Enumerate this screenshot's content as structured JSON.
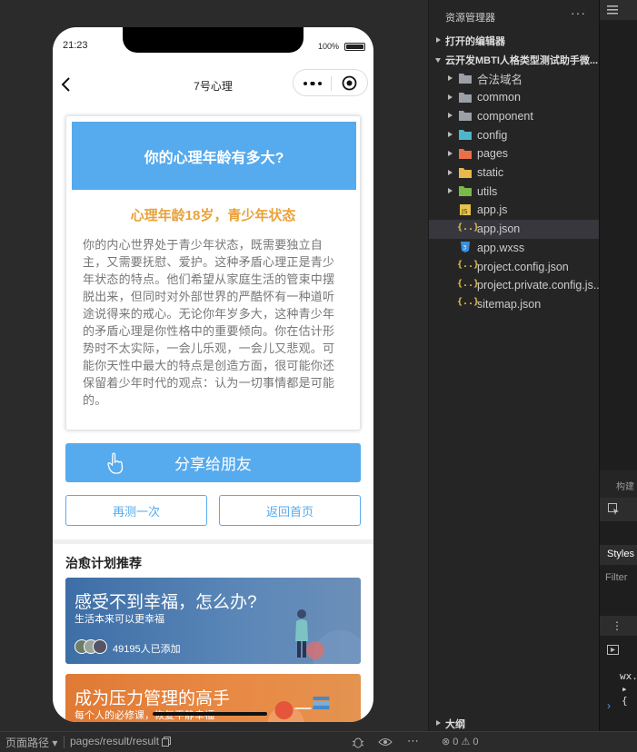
{
  "phone": {
    "time": "21:23",
    "battery": "100%",
    "nav_title": "7号心理",
    "card_banner": "你的心理年龄有多大?",
    "result_title": "心理年龄18岁，青少年状态",
    "result_desc": "你的内心世界处于青少年状态，既需要独立自主，又需要抚慰、爱护。这种矛盾心理正是青少年状态的特点。他们希望从家庭生活的管束中摆脱出来，但同时对外部世界的严酷怀有一种道听途说得来的戒心。无论你年岁多大，这种青少年的矛盾心理是你性格中的重要倾向。你在估计形势时不太实际，一会儿乐观，一会儿又悲观。可能你天性中最大的特点是创造方面，很可能你还保留着少年时代的观点：认为一切事情都是可能的。",
    "share_label": "分享给朋友",
    "again_label": "再测一次",
    "home_label": "返回首页",
    "section_title": "治愈计划推荐",
    "recommendations": [
      {
        "title": "感受不到幸福，怎么办?",
        "subtitle": "生活本来可以更幸福",
        "count": "49195人已添加"
      },
      {
        "title": "成为压力管理的高手",
        "subtitle": "每个人的必修课，恢复平静幸福"
      }
    ]
  },
  "explorer": {
    "header": "资源管理器",
    "more": "···",
    "open_editors": "打开的编辑器",
    "project": "云开发MBTI人格类型测试助手微...",
    "items": [
      {
        "label": "合法域名",
        "type": "folder"
      },
      {
        "label": "common",
        "type": "folder"
      },
      {
        "label": "component",
        "type": "folder"
      },
      {
        "label": "config",
        "type": "folder-config"
      },
      {
        "label": "pages",
        "type": "folder-pages"
      },
      {
        "label": "static",
        "type": "folder-static"
      },
      {
        "label": "utils",
        "type": "folder-utils"
      },
      {
        "label": "app.js",
        "type": "js"
      },
      {
        "label": "app.json",
        "type": "json"
      },
      {
        "label": "app.wxss",
        "type": "wxss"
      },
      {
        "label": "project.config.json",
        "type": "json"
      },
      {
        "label": "project.private.config.js...",
        "type": "json"
      },
      {
        "label": "sitemap.json",
        "type": "json"
      }
    ],
    "outline": "大纲"
  },
  "bottombar": {
    "path_label": "页面路径 ▾",
    "path": "pages/result/result",
    "errors": "⊗ 0 ⚠ 0"
  },
  "rightpanel": {
    "build_label": "构建",
    "styles_tab": "Styles",
    "filter_placeholder": "Filter",
    "code_line1": "wx.",
    "code_line2": "▸ {",
    "prompt": "›"
  },
  "colors": {
    "accent": "#56aaee",
    "result_title": "#e9a23b",
    "editor_bg": "#252526"
  }
}
